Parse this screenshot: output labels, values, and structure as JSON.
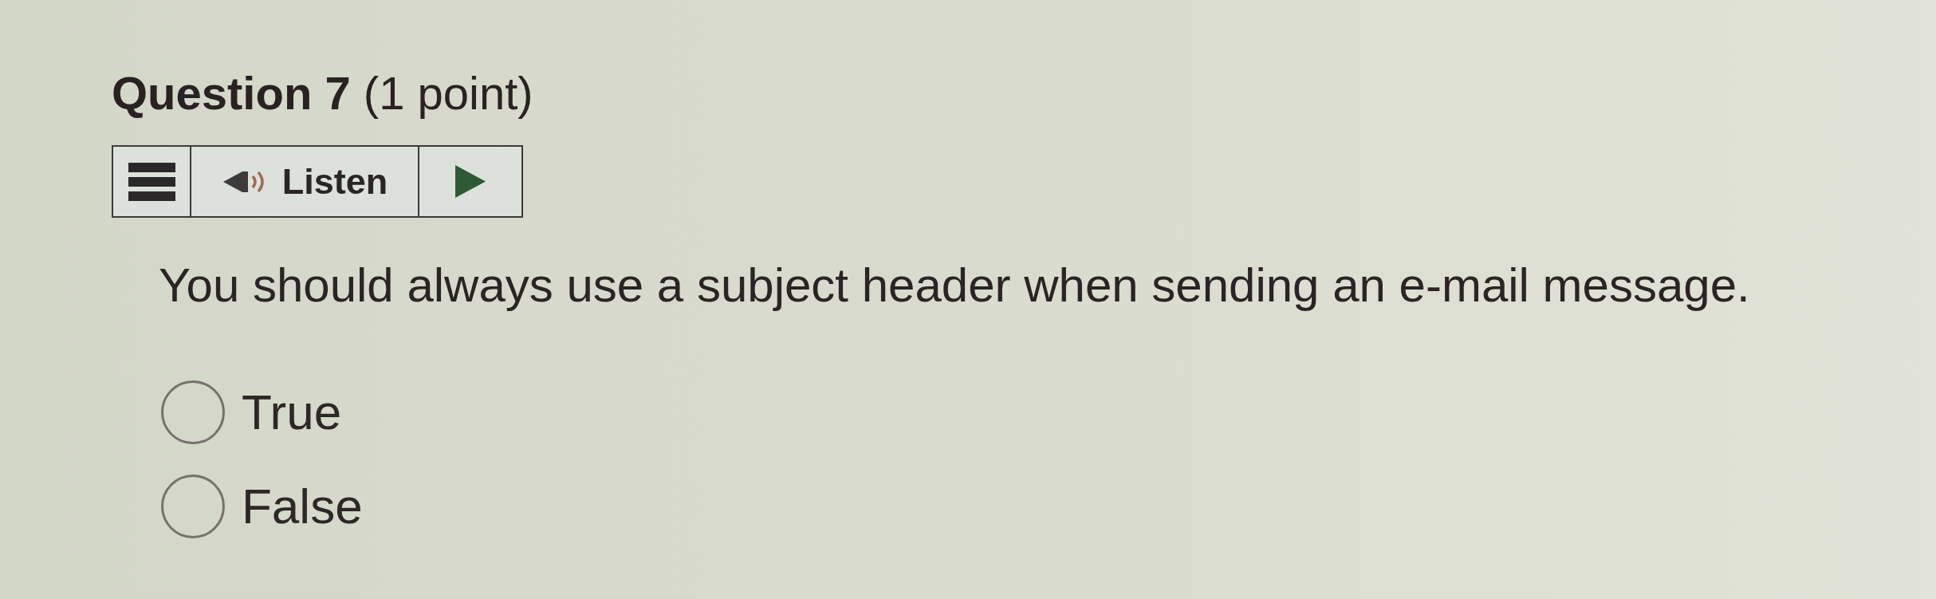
{
  "question": {
    "title": "**Question 7** (1 point)",
    "listen_toolbar": {
      "label": "Listen"
    },
    "prompt": "You should always use a subject header when sending an e-mail message.",
    "options": [
      {
        "label": "True",
        "selected": false
      },
      {
        "label": "False",
        "selected": false
      }
    ]
  }
}
